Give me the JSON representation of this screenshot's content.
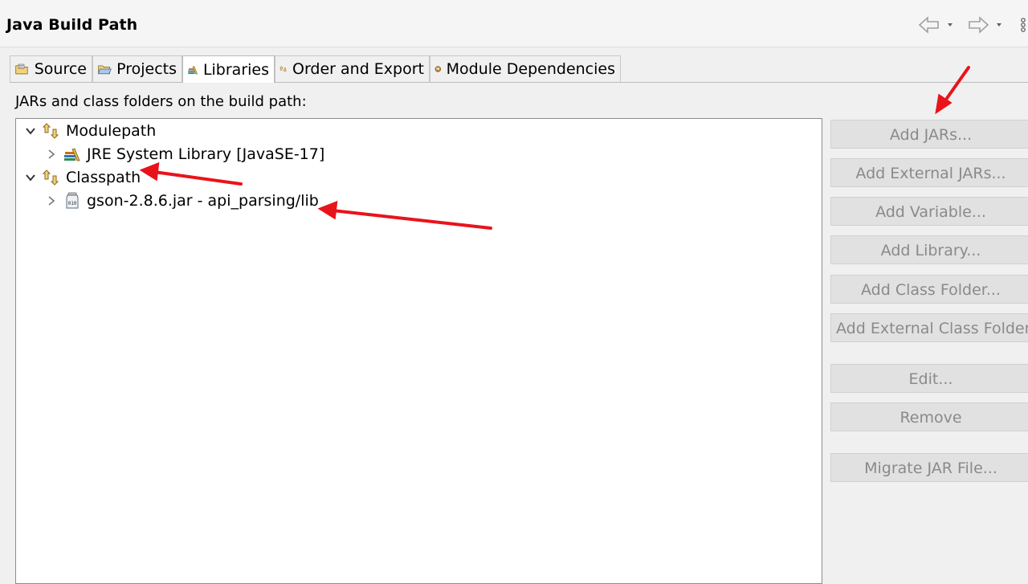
{
  "header": {
    "title": "Java Build Path"
  },
  "tabs": [
    {
      "label": "Source",
      "icon": "source-folder-icon"
    },
    {
      "label": "Projects",
      "icon": "projects-folder-icon"
    },
    {
      "label": "Libraries",
      "icon": "libraries-icon",
      "active": true
    },
    {
      "label": "Order and Export",
      "icon": "order-export-icon"
    },
    {
      "label": "Module Dependencies",
      "icon": "module-icon"
    }
  ],
  "build_path_label": "JARs and class folders on the build path:",
  "tree": [
    {
      "label": "Modulepath",
      "expanded": true,
      "level": 0,
      "icon": "path-container-icon"
    },
    {
      "label": "JRE System Library [JavaSE-17]",
      "expanded": false,
      "level": 1,
      "icon": "library-icon"
    },
    {
      "label": "Classpath",
      "expanded": true,
      "level": 0,
      "icon": "path-container-icon"
    },
    {
      "label": "gson-2.8.6.jar - api_parsing/lib",
      "expanded": false,
      "level": 1,
      "icon": "jar-icon"
    }
  ],
  "buttons": [
    "Add JARs...",
    "Add External JARs...",
    "Add Variable...",
    "Add Library...",
    "Add Class Folder...",
    "Add External Class Folder...",
    "Edit...",
    "Remove",
    "Migrate JAR File..."
  ],
  "colors": {
    "annotation_arrow": "#e8141b",
    "disabled_text": "#8a8a8a"
  }
}
